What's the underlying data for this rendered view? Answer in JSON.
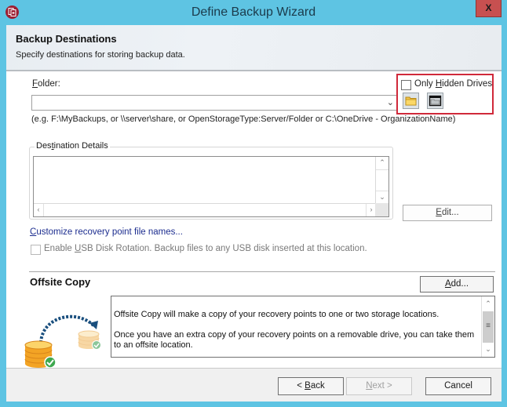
{
  "window": {
    "title": "Define Backup Wizard",
    "close_label": "X",
    "accent_color": "#5ec4e3"
  },
  "header": {
    "title": "Backup Destinations",
    "subtitle": "Specify destinations for storing backup data."
  },
  "folder": {
    "label_mnemonic": "F",
    "label_rest": "older:",
    "value": "",
    "hint": "(e.g. F:\\MyBackups, or \\\\server\\share, or OpenStorageType:Server/Folder or C:\\OneDrive - OrganizationName)"
  },
  "hidden_drives": {
    "label_pre": "Only ",
    "label_mnemonic": "H",
    "label_post": "idden Drives",
    "checked": false,
    "browse_folder_icon": "folder-open-icon",
    "browse_network_icon": "drive-window-icon"
  },
  "destination_details": {
    "label_pre": "Des",
    "label_mnemonic": "t",
    "label_post": "ination Details",
    "edit_mnemonic": "E",
    "edit_rest": "dit..."
  },
  "customize_link": {
    "mnemonic": "C",
    "rest": "ustomize recovery point file names..."
  },
  "usb_rotation": {
    "label_pre": "Enable ",
    "label_mnemonic": "U",
    "label_post": "SB Disk Rotation. Backup files to any USB disk inserted at this location.",
    "checked": false
  },
  "offsite": {
    "title": "Offsite Copy",
    "add_mnemonic": "A",
    "add_rest": "dd...",
    "text1": "Offsite Copy will make a copy of your recovery points to one or two storage locations.",
    "text2": "Once you have an extra copy of your recovery points on a removable drive, you can take them to an offsite location."
  },
  "footer": {
    "back_pre": "< ",
    "back_mnemonic": "B",
    "back_rest": "ack",
    "next_mnemonic": "N",
    "next_rest": "ext >",
    "cancel": "Cancel"
  }
}
